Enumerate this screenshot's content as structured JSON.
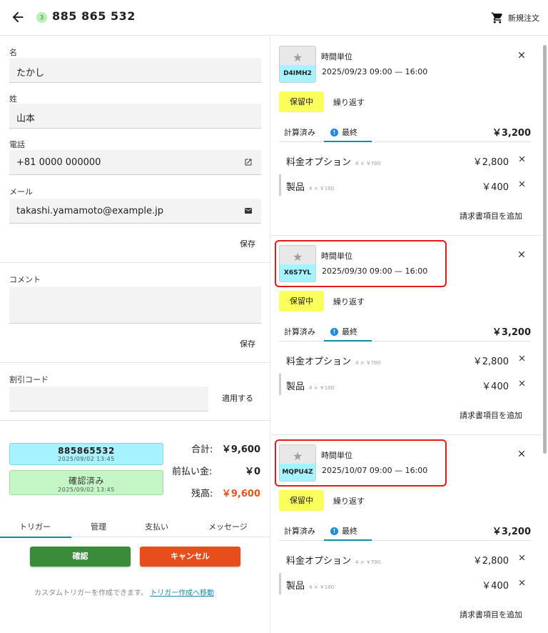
{
  "header": {
    "badge": "3",
    "title": "885 865 532",
    "new_order": "新規注文"
  },
  "form": {
    "first_name_label": "名",
    "first_name": "たかし",
    "last_name_label": "姓",
    "last_name": "山本",
    "phone_label": "電話",
    "phone": "+81 0000 000000",
    "email_label": "メール",
    "email": "takashi.yamamoto@example.jp",
    "save": "保存",
    "comment_label": "コメント",
    "comment_save": "保存",
    "discount_label": "割引コード",
    "apply": "適用する"
  },
  "status": {
    "order_code": "885865532",
    "order_time": "2025/09/02 13:45",
    "confirmed": "確認済み",
    "confirmed_time": "2025/09/02 13:45"
  },
  "summary": {
    "total_label": "合計:",
    "total": "￥9,600",
    "prepaid_label": "前払い金:",
    "prepaid": "￥0",
    "balance_label": "残高:",
    "balance": "￥9,600",
    "balance_color": "#e8541c"
  },
  "tabs": [
    "トリガー",
    "管理",
    "支払い",
    "メッセージ"
  ],
  "actions": {
    "confirm": "確認",
    "cancel": "キャンセル",
    "custom_text": "カスタムトリガーを作成できます。",
    "custom_link": "トリガー作成へ移動"
  },
  "cards": [
    {
      "code": "D4IMH2",
      "unit": "時間単位",
      "range": "2025/09/23 09:00 — 16:00",
      "hold": "保留中",
      "repeat": "繰り返す",
      "tab_calc": "計算済み",
      "tab_final": "最終",
      "total": "￥3,200",
      "items": [
        {
          "name": "料金オプション",
          "sub": "4 × ￥700",
          "amount": "￥2,800"
        },
        {
          "name": "製品",
          "sub": "4 × ￥100",
          "amount": "￥400"
        }
      ],
      "add": "請求書項目を追加",
      "highlighted": false
    },
    {
      "code": "X6S7YL",
      "unit": "時間単位",
      "range": "2025/09/30 09:00 — 16:00",
      "hold": "保留中",
      "repeat": "繰り返す",
      "tab_calc": "計算済み",
      "tab_final": "最終",
      "total": "￥3,200",
      "items": [
        {
          "name": "料金オプション",
          "sub": "4 × ￥700",
          "amount": "￥2,800"
        },
        {
          "name": "製品",
          "sub": "4 × ￥100",
          "amount": "￥400"
        }
      ],
      "add": "請求書項目を追加",
      "highlighted": true
    },
    {
      "code": "MQPU4Z",
      "unit": "時間単位",
      "range": "2025/10/07 09:00 — 16:00",
      "hold": "保留中",
      "repeat": "繰り返す",
      "tab_calc": "計算済み",
      "tab_final": "最終",
      "total": "￥3,200",
      "items": [
        {
          "name": "料金オプション",
          "sub": "4 × ￥700",
          "amount": "￥2,800"
        },
        {
          "name": "製品",
          "sub": "4 × ￥100",
          "amount": "￥400"
        }
      ],
      "add": "請求書項目を追加",
      "highlighted": true
    }
  ]
}
